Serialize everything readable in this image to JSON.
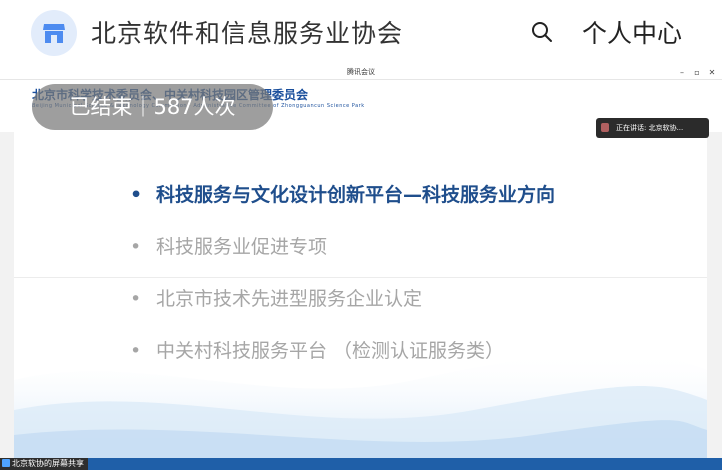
{
  "site": {
    "title": "北京软件和信息服务业协会",
    "personal_center": "个人中心"
  },
  "meeting": {
    "window_title": "腾讯会议",
    "org_name": "北京市科学技术委员会、中关村科技园区管理委员会",
    "org_english": "Beijing Municipal Science & Technology Commission · Administrative Committee of Zhongguancun Science Park",
    "status_badge": "已结束｜587人次",
    "speaker_label": "正在讲话: 北京软协...",
    "share_label": "北京软协的屏幕共享"
  },
  "slide": {
    "bullets": [
      {
        "text": "科技服务与文化设计创新平台—科技服务业方向",
        "state": "active"
      },
      {
        "text": "科技服务业促进专项",
        "state": "dim"
      },
      {
        "text": "北京市技术先进型服务企业认定",
        "state": "dim"
      },
      {
        "text": "中关村科技服务平台 （检测认证服务类）",
        "state": "dim"
      }
    ],
    "bullet_symbol": "•"
  },
  "colors": {
    "accent": "#1f4e8c",
    "dim_text": "#a6a6a6",
    "taskbar": "#1f5fa8"
  },
  "icons": {
    "logo": "store-icon",
    "search": "search-icon",
    "minimize": "minimize-icon",
    "restore": "restore-icon",
    "close": "close-icon"
  }
}
